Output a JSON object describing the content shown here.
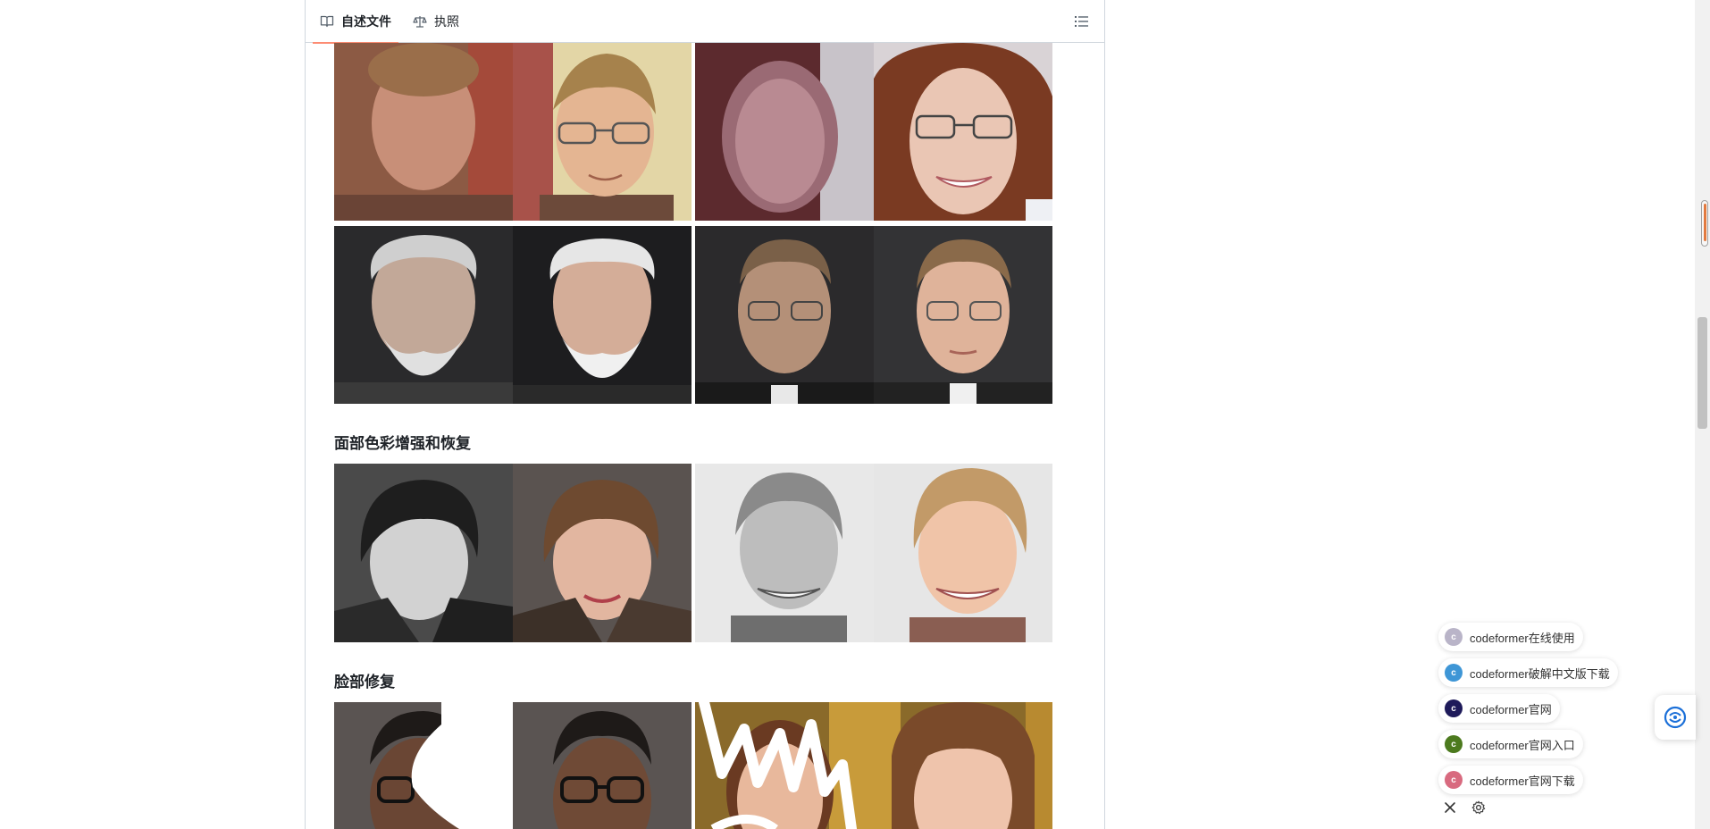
{
  "tabs": [
    {
      "label": "自述文件",
      "icon": "book-icon"
    },
    {
      "label": "执照",
      "icon": "scale-icon"
    }
  ],
  "toc_icon": "list-icon",
  "sections": [
    {
      "title": "面部色彩增强和恢复"
    },
    {
      "title": "脸部修复"
    }
  ],
  "images": [
    {
      "caption": "",
      "kind": "face-comparison"
    }
  ],
  "suggestions": [
    {
      "label": "codeformer在线使用",
      "avatar": "c",
      "color": "#b9b4c8"
    },
    {
      "label": "codeformer破解中文版下载",
      "avatar": "c",
      "color": "#3e96d6"
    },
    {
      "label": "codeformer官网",
      "avatar": "c",
      "color": "#1e1a5a"
    },
    {
      "label": "codeformer官网入口",
      "avatar": "c",
      "color": "#4c7a1e"
    },
    {
      "label": "codeformer官网下载",
      "avatar": "c",
      "color": "#d86a7f"
    }
  ],
  "floating_controls": {
    "close": "close-icon",
    "settings": "gear-icon",
    "assistant": "assistant-icon"
  }
}
